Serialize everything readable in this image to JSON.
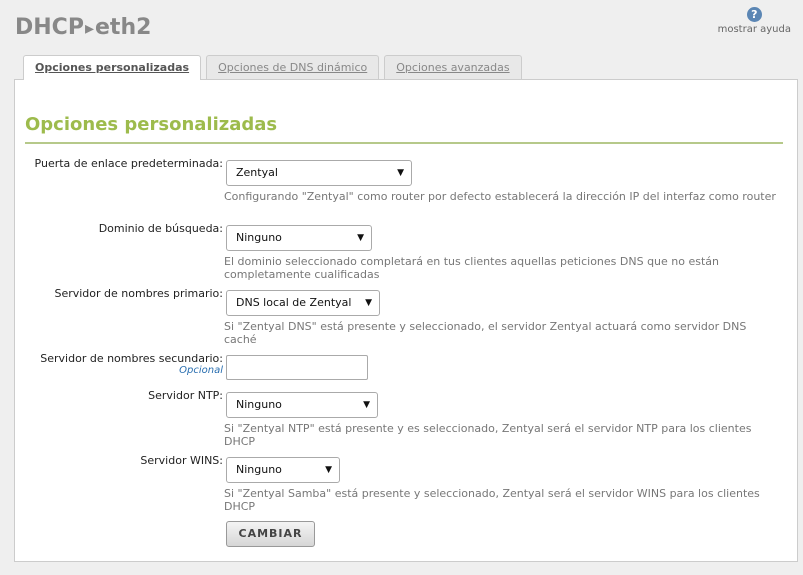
{
  "header": {
    "title_part1": "DHCP",
    "separator": "▸",
    "title_part2": "eth2",
    "help_icon": "?",
    "help_label": "mostrar ayuda"
  },
  "tabs": [
    {
      "label": "Opciones personalizadas",
      "active": true
    },
    {
      "label": "Opciones de DNS dinámico",
      "active": false
    },
    {
      "label": "Opciones avanzadas",
      "active": false
    }
  ],
  "section": {
    "title": "Opciones personalizadas"
  },
  "fields": {
    "gateway": {
      "label": "Puerta de enlace predeterminada:",
      "value": "Zentyal",
      "hint": "Configurando \"Zentyal\" como router por defecto establecerá la dirección IP del interfaz como router"
    },
    "search_domain": {
      "label": "Dominio de búsqueda:",
      "value": "Ninguno",
      "hint": "El dominio seleccionado completará en tus clientes aquellas peticiones DNS que no están completamente cualificadas"
    },
    "primary_ns": {
      "label": "Servidor de nombres primario:",
      "value": "DNS local de Zentyal",
      "hint": "Si \"Zentyal DNS\" está presente y seleccionado, el servidor Zentyal actuará como servidor DNS caché"
    },
    "secondary_ns": {
      "label": "Servidor de nombres secundario:",
      "optional": "Opcional",
      "value": ""
    },
    "ntp": {
      "label": "Servidor NTP:",
      "value": "Ninguno",
      "hint": "Si \"Zentyal NTP\" está presente y es seleccionado, Zentyal será el servidor NTP para los clientes DHCP"
    },
    "wins": {
      "label": "Servidor WINS:",
      "value": "Ninguno",
      "hint": "Si \"Zentyal Samba\" está presente y seleccionado, Zentyal será el servidor WINS para los clientes DHCP"
    }
  },
  "arrow_glyph": "▼",
  "submit_label": "CAMBIAR"
}
